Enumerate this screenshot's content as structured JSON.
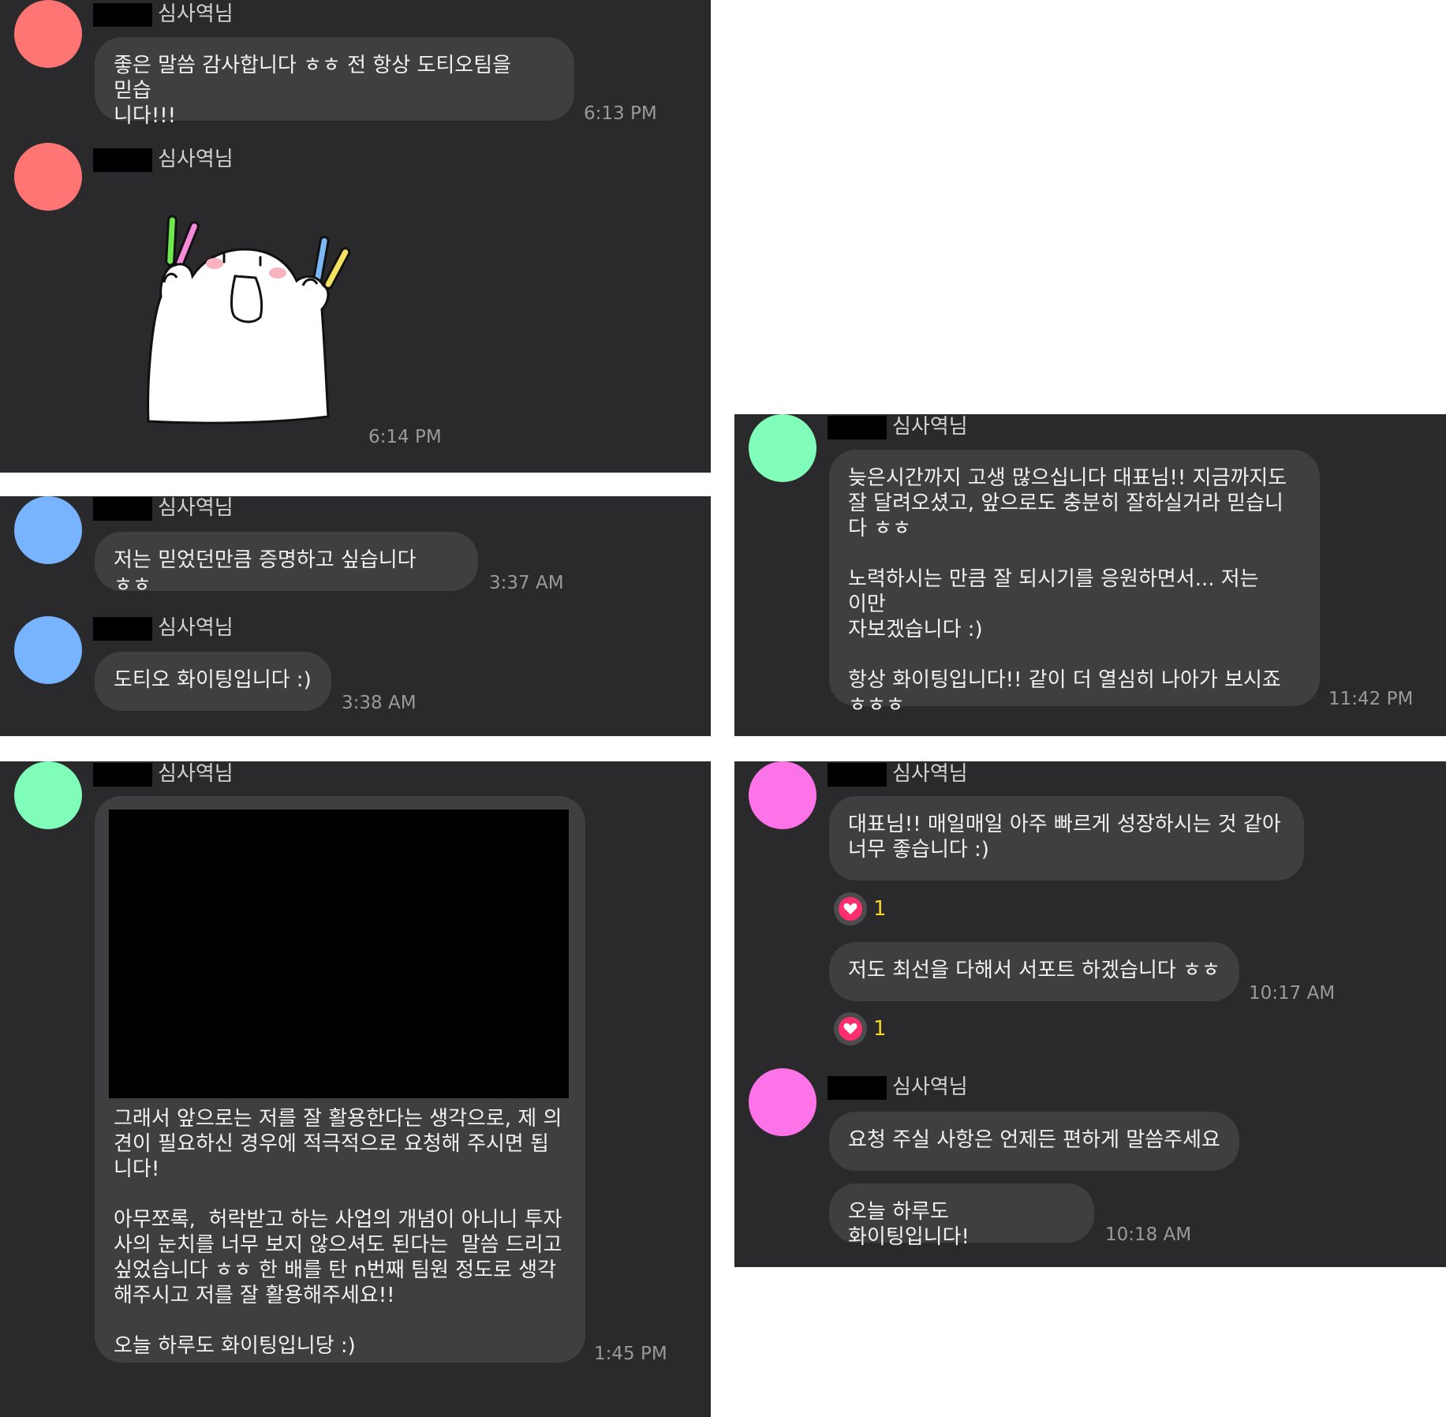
{
  "colors": {
    "panel_bg": "#2a2a2c",
    "bubble_bg": "#3f3f41",
    "avatar_red": "#fe7574",
    "avatar_blue": "#77b3fe",
    "avatar_green": "#7ffdb9",
    "avatar_pink": "#fe74e8",
    "reaction_heart": "#ff2e6e",
    "reaction_count": "#f5d41e"
  },
  "panel1": {
    "msg1": {
      "sender": "심사역님",
      "text": "좋은 말씀 감사합니다 ㅎㅎ 전 항상 도티오팀을 믿습\n니다!!!",
      "time": "6:13 PM"
    },
    "msg2": {
      "sender": "심사역님",
      "sticker": "cheering-ghost-sticker",
      "time": "6:14 PM"
    }
  },
  "panel2": {
    "msg1": {
      "sender": "심사역님",
      "text": "저는 믿었던만큼 증명하고 싶습니다 ㅎㅎ",
      "time": "3:37 AM"
    },
    "msg2": {
      "sender": "심사역님",
      "text": "도티오 화이팅입니다 :)",
      "time": "3:38 AM"
    }
  },
  "panel3": {
    "msg1": {
      "sender": "심사역님",
      "text": "그래서 앞으로는 저를 잘 활용한다는 생각으로, 제 의\n견이 필요하신 경우에 적극적으로 요청해 주시면 됩\n니다!\n\n아무쪼록,  허락받고 하는 사업의 개념이 아니니 투자\n사의 눈치를 너무 보지 않으셔도 된다는  말씀 드리고\n싶었습니다 ㅎㅎ 한 배를 탄 n번째 팀원 정도로 생각\n해주시고 저를 잘 활용해주세요!!\n\n오늘 하루도 화이팅입니당 :)",
      "time": "1:45 PM"
    }
  },
  "panel4": {
    "msg1": {
      "sender": "심사역님",
      "text": "늦은시간까지 고생 많으십니다 대표님!! 지금까지도\n잘 달려오셨고, 앞으로도 충분히 잘하실거라 믿습니\n다 ㅎㅎ\n\n노력하시는 만큼 잘 되시기를 응원하면서... 저는 이만\n자보겠습니다 :)\n\n항상 화이팅입니다!! 같이 더 열심히 나아가 보시죠\nㅎㅎㅎ",
      "time": "11:42 PM"
    }
  },
  "panel5": {
    "msg1": {
      "sender": "심사역님",
      "text1": "대표님!! 매일매일 아주 빠르게 성장하시는 것 같아\n너무 좋습니다 :)",
      "reaction1": "1",
      "text2": "저도 최선을 다해서 서포트 하겠습니다 ㅎㅎ",
      "time1": "10:17 AM",
      "reaction2": "1"
    },
    "msg2": {
      "sender": "심사역님",
      "text1": "요청 주실 사항은 언제든 편하게 말씀주세요",
      "text2": "오늘 하루도 화이팅입니다!",
      "time": "10:18 AM"
    }
  }
}
